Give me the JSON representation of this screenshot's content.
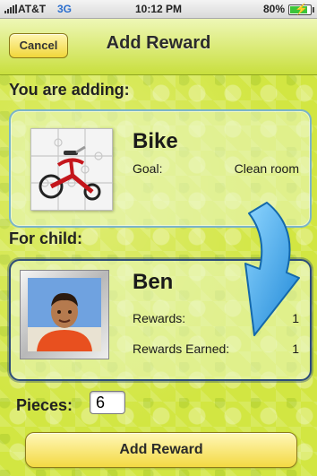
{
  "status_bar": {
    "carrier": "AT&T",
    "network": "3G",
    "time": "10:12 PM",
    "battery": "80%",
    "battery_level": 0.8
  },
  "nav": {
    "cancel_label": "Cancel",
    "title": "Add Reward"
  },
  "reward_section": {
    "heading": "You are adding:",
    "reward_name": "Bike",
    "goal_label": "Goal:",
    "goal_value": "Clean room"
  },
  "child_section": {
    "heading": "For child:",
    "child_name": "Ben",
    "rewards_label": "Rewards:",
    "rewards_value": "1",
    "rewards_earned_label": "Rewards Earned:",
    "rewards_earned_value": "1"
  },
  "pieces": {
    "label": "Pieces:",
    "value": "6"
  },
  "actions": {
    "add_reward_label": "Add Reward"
  },
  "colors": {
    "background": "#d2e642",
    "button": "#f3d943",
    "arrow": "#2e9fe0",
    "panel_border": "#7bb5c8"
  },
  "icons": {
    "signal": "signal-bars-icon",
    "battery": "battery-charging-icon",
    "arrow": "curved-arrow-down-icon"
  }
}
